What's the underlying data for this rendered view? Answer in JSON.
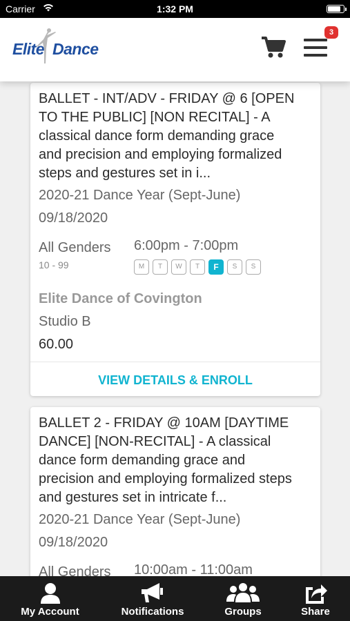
{
  "status_bar": {
    "carrier": "Carrier",
    "time": "1:32 PM"
  },
  "header": {
    "logo_word1": "Elite",
    "logo_word2": "Dance",
    "cart_icon": "cart-icon",
    "menu_icon": "menu-icon",
    "badge_count": "3"
  },
  "classes": [
    {
      "title": "BALLET - INT/ADV - FRIDAY @ 6 [OPEN TO THE PUBLIC] [NON RECITAL] - A classical dance form demanding grace and precision and employing formalized steps and gestures set in i...",
      "title_lines": [
        "BALLET - INT/ADV - FRIDAY @ 6 [OPEN",
        "TO THE PUBLIC] [NON RECITAL] - A",
        "classical dance form demanding grace",
        "and precision and employing formalized",
        "steps and gestures set in i..."
      ],
      "season": "2020-21 Dance Year (Sept-June)",
      "start_date": "09/18/2020",
      "genders": "All Genders",
      "ages": "10 - 99",
      "time": "6:00pm - 7:00pm",
      "days": [
        "M",
        "T",
        "W",
        "T",
        "F",
        "S",
        "S"
      ],
      "active_day": "F",
      "location": "Elite Dance of Covington",
      "room": "Studio B",
      "price": "60.00",
      "action": "VIEW DETAILS & ENROLL"
    },
    {
      "title": "BALLET 2 - FRIDAY @ 10AM [DAYTIME DANCE] [NON-RECITAL] - A classical dance form demanding grace and precision and employing formalized steps and gestures set in intricate f...",
      "title_lines": [
        "BALLET 2 - FRIDAY @ 10AM [DAYTIME",
        "DANCE] [NON-RECITAL] - A classical",
        "dance form demanding grace and",
        "precision and employing formalized steps",
        "and gestures set in intricate f..."
      ],
      "season": "2020-21 Dance Year (Sept-June)",
      "start_date": "09/18/2020",
      "genders": "All Genders",
      "time": "10:00am - 11:00am"
    }
  ],
  "tabbar": [
    {
      "label": "My Account",
      "icon": "person-icon"
    },
    {
      "label": "Notifications",
      "icon": "megaphone-icon"
    },
    {
      "label": "Groups",
      "icon": "group-icon"
    },
    {
      "label": "Share",
      "icon": "share-icon"
    }
  ],
  "colors": {
    "accent": "#11b4d0",
    "brand": "#1f4fa0",
    "badge": "#e0312f",
    "tabbar_bg": "#1b1b1b"
  }
}
